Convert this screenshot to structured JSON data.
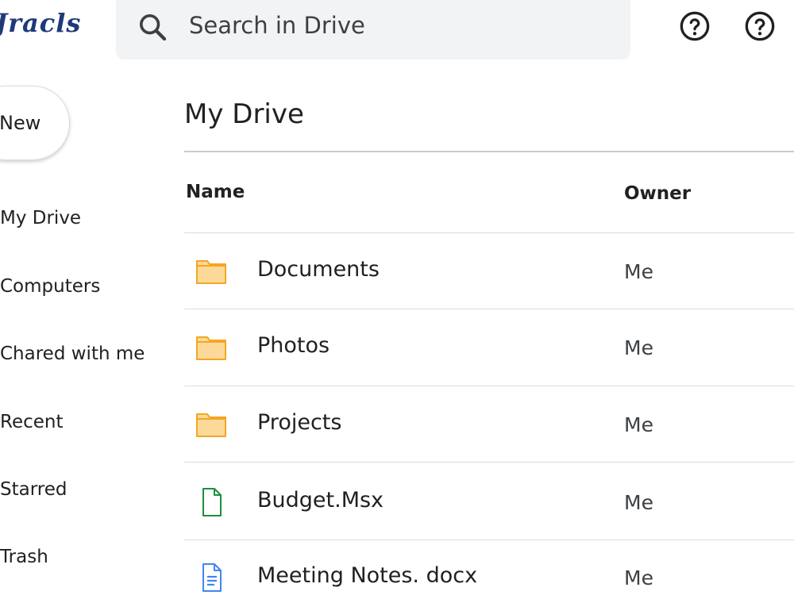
{
  "header": {
    "logo_text": "Jracls",
    "search": {
      "placeholder": "Search in Drive"
    }
  },
  "sidebar": {
    "new_label": "New",
    "items": [
      {
        "label": "My Drive"
      },
      {
        "label": "Computers"
      },
      {
        "label": "Chared with me"
      },
      {
        "label": "Recent"
      },
      {
        "label": "Starred"
      },
      {
        "label": "Trash"
      }
    ]
  },
  "main": {
    "title": "My Drive",
    "columns": {
      "name": "Name",
      "owner": "Owner"
    },
    "files": [
      {
        "name": "Documents",
        "owner": "Me",
        "type": "folder"
      },
      {
        "name": "Photos",
        "owner": "Me",
        "type": "folder"
      },
      {
        "name": "Projects",
        "owner": "Me",
        "type": "folder"
      },
      {
        "name": "Budget.Msx",
        "owner": "Me",
        "type": "spreadsheet"
      },
      {
        "name": "Meeting Notes. docx",
        "owner": "Me",
        "type": "document"
      }
    ]
  },
  "icons": {
    "search": "search-icon",
    "help": "help-icon",
    "folder": "folder-icon",
    "spreadsheet": "spreadsheet-file-icon",
    "document": "document-file-icon"
  },
  "colors": {
    "folder_fill": "#fdd999",
    "folder_stroke": "#f4a623",
    "sheet": "#1e8e3e",
    "doc": "#4285f4",
    "logo": "#1f3a7a",
    "search_bg": "#f1f3f4"
  }
}
